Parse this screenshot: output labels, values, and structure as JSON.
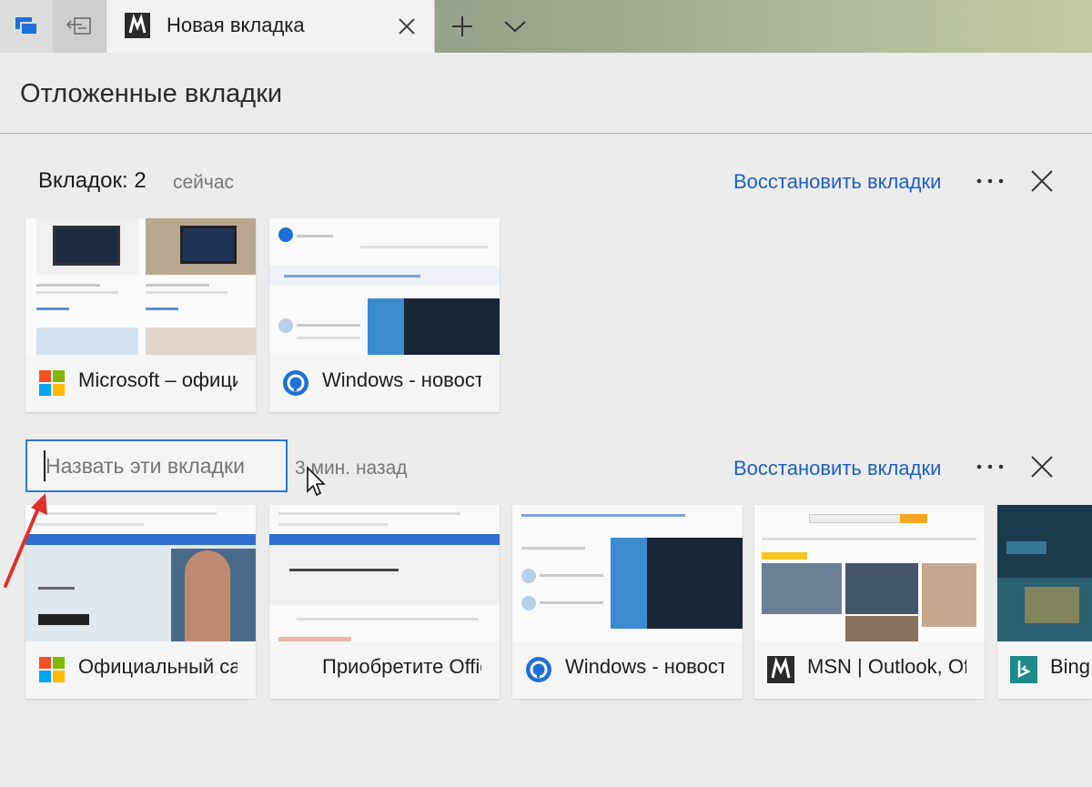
{
  "browser": {
    "active_tab_title": "Новая вкладка"
  },
  "panel": {
    "title": "Отложенные вкладки"
  },
  "groups": [
    {
      "count_label": "Вкладок: 2",
      "time": "сейчас",
      "restore_label": "Восстановить вкладки",
      "tabs": [
        {
          "title": "Microsoft – официальная",
          "icon": "microsoft-logo-icon"
        },
        {
          "title": "Windows - новости",
          "icon": "g-ek-logo-icon"
        }
      ]
    },
    {
      "name_placeholder": "Назвать эти вкладки",
      "time": "3 мин. назад",
      "restore_label": "Восстановить вкладки",
      "tabs": [
        {
          "title": "Официальный сайт",
          "icon": "microsoft-logo-icon"
        },
        {
          "title": "Приобретите Office",
          "icon": "office-icon"
        },
        {
          "title": "Windows - новости",
          "icon": "g-ek-logo-icon"
        },
        {
          "title": "MSN | Outlook, Office",
          "icon": "msn-logo-icon"
        },
        {
          "title": "Bing",
          "icon": "bing-logo-icon"
        }
      ]
    }
  ],
  "colors": {
    "accent": "#1f5fc1",
    "input_border": "#2b7ad4",
    "annotation_arrow": "#e03030"
  }
}
